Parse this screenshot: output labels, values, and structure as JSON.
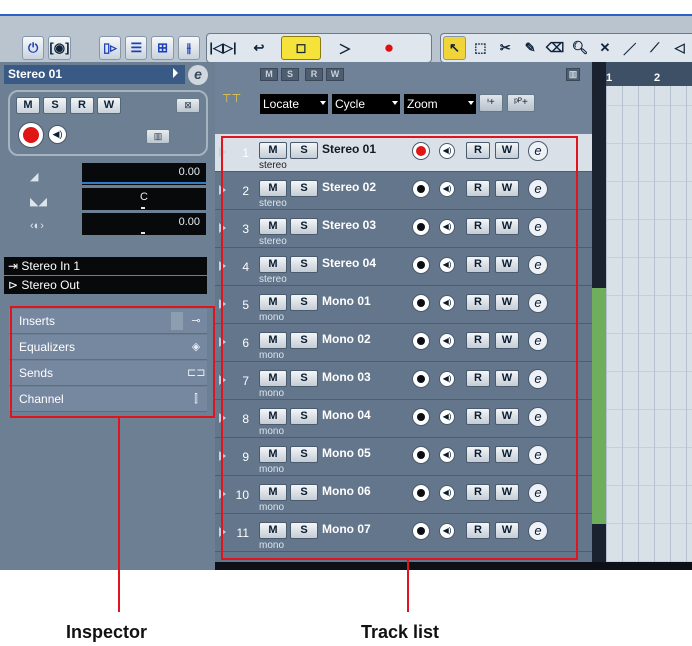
{
  "inspector": {
    "track_title": "Stereo 01",
    "volume_value": "0.00",
    "pan_value": "C",
    "delay_value": "0.00",
    "input_routing": "Stereo In 1",
    "output_routing": "Stereo Out",
    "sections": [
      "Inserts",
      "Equalizers",
      "Sends",
      "Channel"
    ]
  },
  "track_toolbar": {
    "locate_label": "Locate",
    "cycle_label": "Cycle",
    "zoom_label": "Zoom"
  },
  "tracks": [
    {
      "number": "1",
      "name": "Stereo 01",
      "type": "stereo",
      "selected": true
    },
    {
      "number": "2",
      "name": "Stereo 02",
      "type": "stereo"
    },
    {
      "number": "3",
      "name": "Stereo 03",
      "type": "stereo"
    },
    {
      "number": "4",
      "name": "Stereo 04",
      "type": "stereo"
    },
    {
      "number": "5",
      "name": "Mono 01",
      "type": "mono"
    },
    {
      "number": "6",
      "name": "Mono 02",
      "type": "mono"
    },
    {
      "number": "7",
      "name": "Mono 03",
      "type": "mono"
    },
    {
      "number": "8",
      "name": "Mono 04",
      "type": "mono"
    },
    {
      "number": "9",
      "name": "Mono 05",
      "type": "mono"
    },
    {
      "number": "10",
      "name": "Mono 06",
      "type": "mono"
    },
    {
      "number": "11",
      "name": "Mono 07",
      "type": "mono"
    }
  ],
  "ruler": {
    "bar1": "1",
    "bar2": "2"
  },
  "callouts": {
    "inspector": "Inspector",
    "track_list": "Track list"
  },
  "colors": {
    "highlight": "#e0141c",
    "record": "#e01515",
    "stop_active": "#f5e23a"
  }
}
